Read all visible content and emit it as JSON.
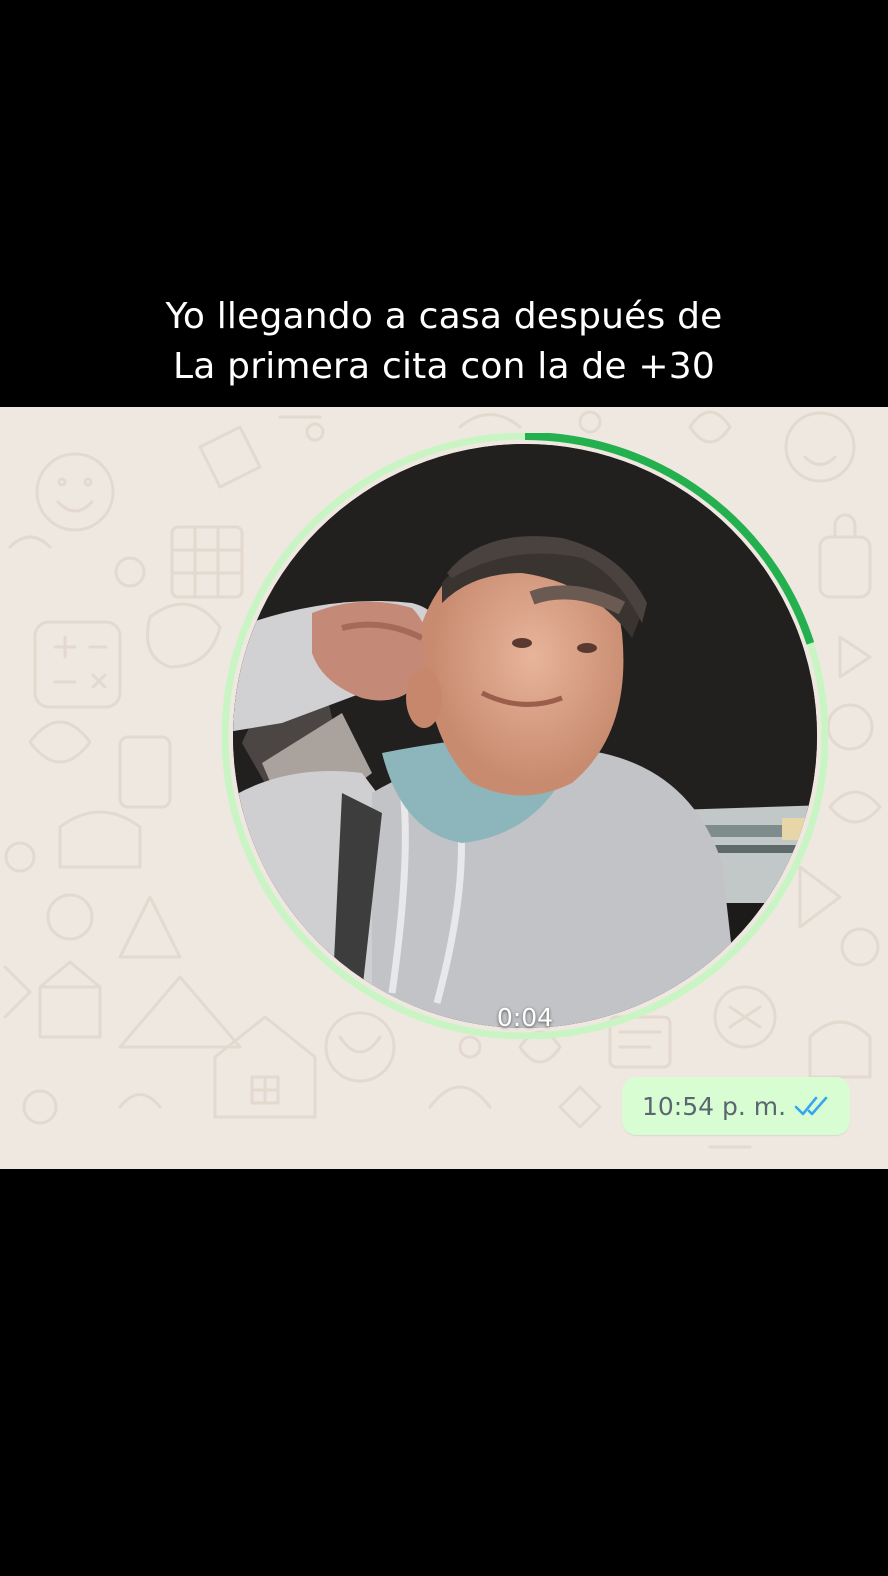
{
  "caption": {
    "line1": "Yo llegando a casa después de",
    "line2": "La primera cita con la de +30"
  },
  "video_note": {
    "duration": "0:04",
    "progress": 0.2,
    "ring_color": "#c9f5c4",
    "progress_color": "#25b04f"
  },
  "message": {
    "time": "10:54 p. m.",
    "status_icon": "double-check-read-icon",
    "check_color": "#34a7f0"
  },
  "colors": {
    "wallpaper": "#efe8e0",
    "bubble": "#d9fdd3"
  }
}
